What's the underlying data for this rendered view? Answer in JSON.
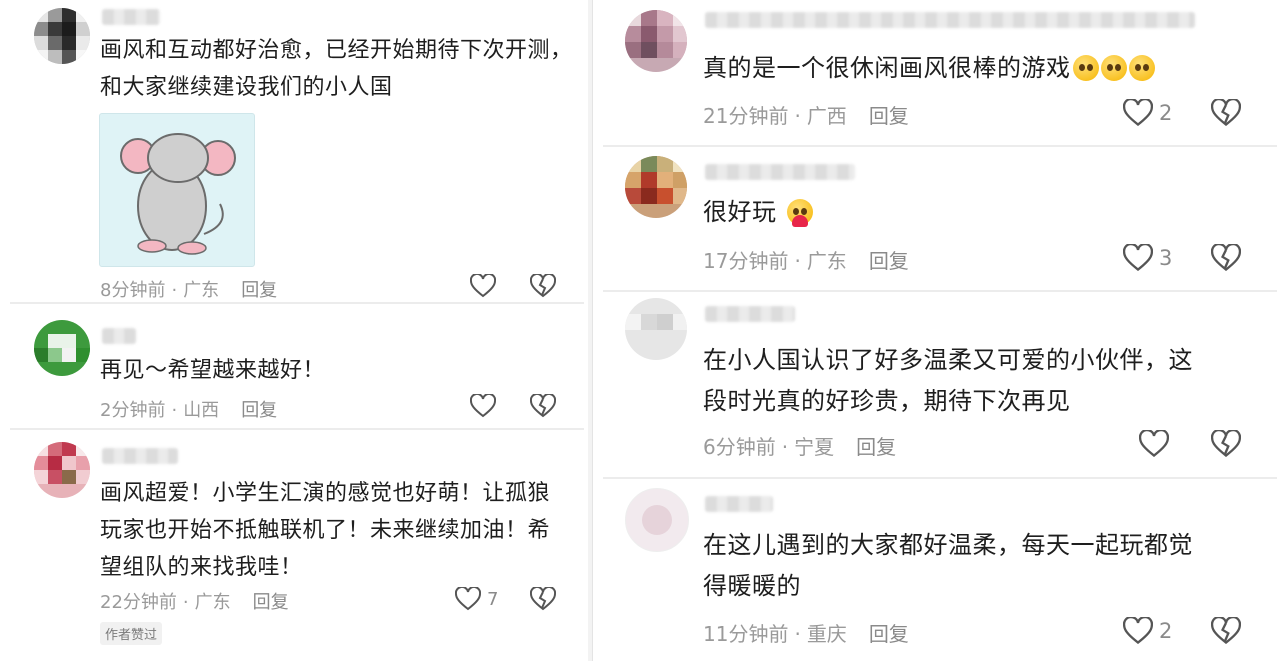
{
  "left_column": {
    "comments": [
      {
        "text_lines": [
          "画风和互动都好治愈，已经开始期待下次开测，",
          "和大家继续建设我们的小人国"
        ],
        "time": "8分钟前",
        "location": "广东",
        "reply_label": "回复",
        "like_count": ""
      },
      {
        "text_lines": [
          "再见～希望越来越好！"
        ],
        "time": "2分钟前",
        "location": "山西",
        "reply_label": "回复",
        "like_count": ""
      },
      {
        "text_lines": [
          "画风超爱！小学生汇演的感觉也好萌！让孤狼",
          "玩家也开始不抵触联机了！未来继续加油！希",
          "望组队的来找我哇！"
        ],
        "time": "22分钟前",
        "location": "广东",
        "reply_label": "回复",
        "like_count": "7",
        "badge": "作者赞过"
      }
    ]
  },
  "right_column": {
    "comments": [
      {
        "text_lines": [
          "真的是一个很休闲画风很棒的游戏"
        ],
        "time": "21分钟前",
        "location": "广西",
        "reply_label": "回复",
        "like_count": "2"
      },
      {
        "text_lines": [
          "很好玩"
        ],
        "time": "17分钟前",
        "location": "广东",
        "reply_label": "回复",
        "like_count": "3"
      },
      {
        "text_lines": [
          "在小人国认识了好多温柔又可爱的小伙伴，这",
          "段时光真的好珍贵，期待下次再见"
        ],
        "time": "6分钟前",
        "location": "宁夏",
        "reply_label": "回复",
        "like_count": ""
      },
      {
        "text_lines": [
          "在这儿遇到的大家都好温柔，每天一起玩都觉",
          "得暖暖的"
        ],
        "time": "11分钟前",
        "location": "重庆",
        "reply_label": "回复",
        "like_count": "2"
      }
    ]
  },
  "separator_dot": "·",
  "icons": {
    "like": "heart-outline-icon",
    "dislike": "broken-heart-icon",
    "emoji": "pleading-face-emoji"
  }
}
